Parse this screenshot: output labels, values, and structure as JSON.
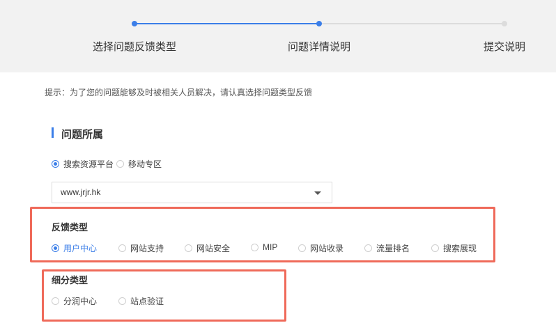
{
  "steps": [
    {
      "label": "选择问题反馈类型",
      "state": "done"
    },
    {
      "label": "问题详情说明",
      "state": "active"
    },
    {
      "label": "提交说明",
      "state": "pending"
    }
  ],
  "hint": "提示：为了您的问题能够及时被相关人员解决，请认真选择问题类型反馈",
  "section": {
    "title": "问题所属"
  },
  "platform": {
    "options": [
      {
        "label": "搜索资源平台",
        "checked": true
      },
      {
        "label": "移动专区",
        "checked": false
      }
    ]
  },
  "site_select": {
    "value": "www.jrjr.hk"
  },
  "feedback": {
    "title": "反馈类型",
    "options": [
      {
        "label": "用户中心",
        "checked": true
      },
      {
        "label": "网站支持",
        "checked": false
      },
      {
        "label": "网站安全",
        "checked": false
      },
      {
        "label": "MIP",
        "checked": false
      },
      {
        "label": "网站收录",
        "checked": false
      },
      {
        "label": "流量排名",
        "checked": false
      },
      {
        "label": "搜索展现",
        "checked": false
      }
    ]
  },
  "subtype": {
    "title": "细分类型",
    "options": [
      {
        "label": "分润中心",
        "checked": false
      },
      {
        "label": "站点验证",
        "checked": false
      }
    ]
  },
  "colors": {
    "accent": "#3b7ee8",
    "highlight": "#ef6a5a",
    "panel": "#f2f2f2"
  }
}
